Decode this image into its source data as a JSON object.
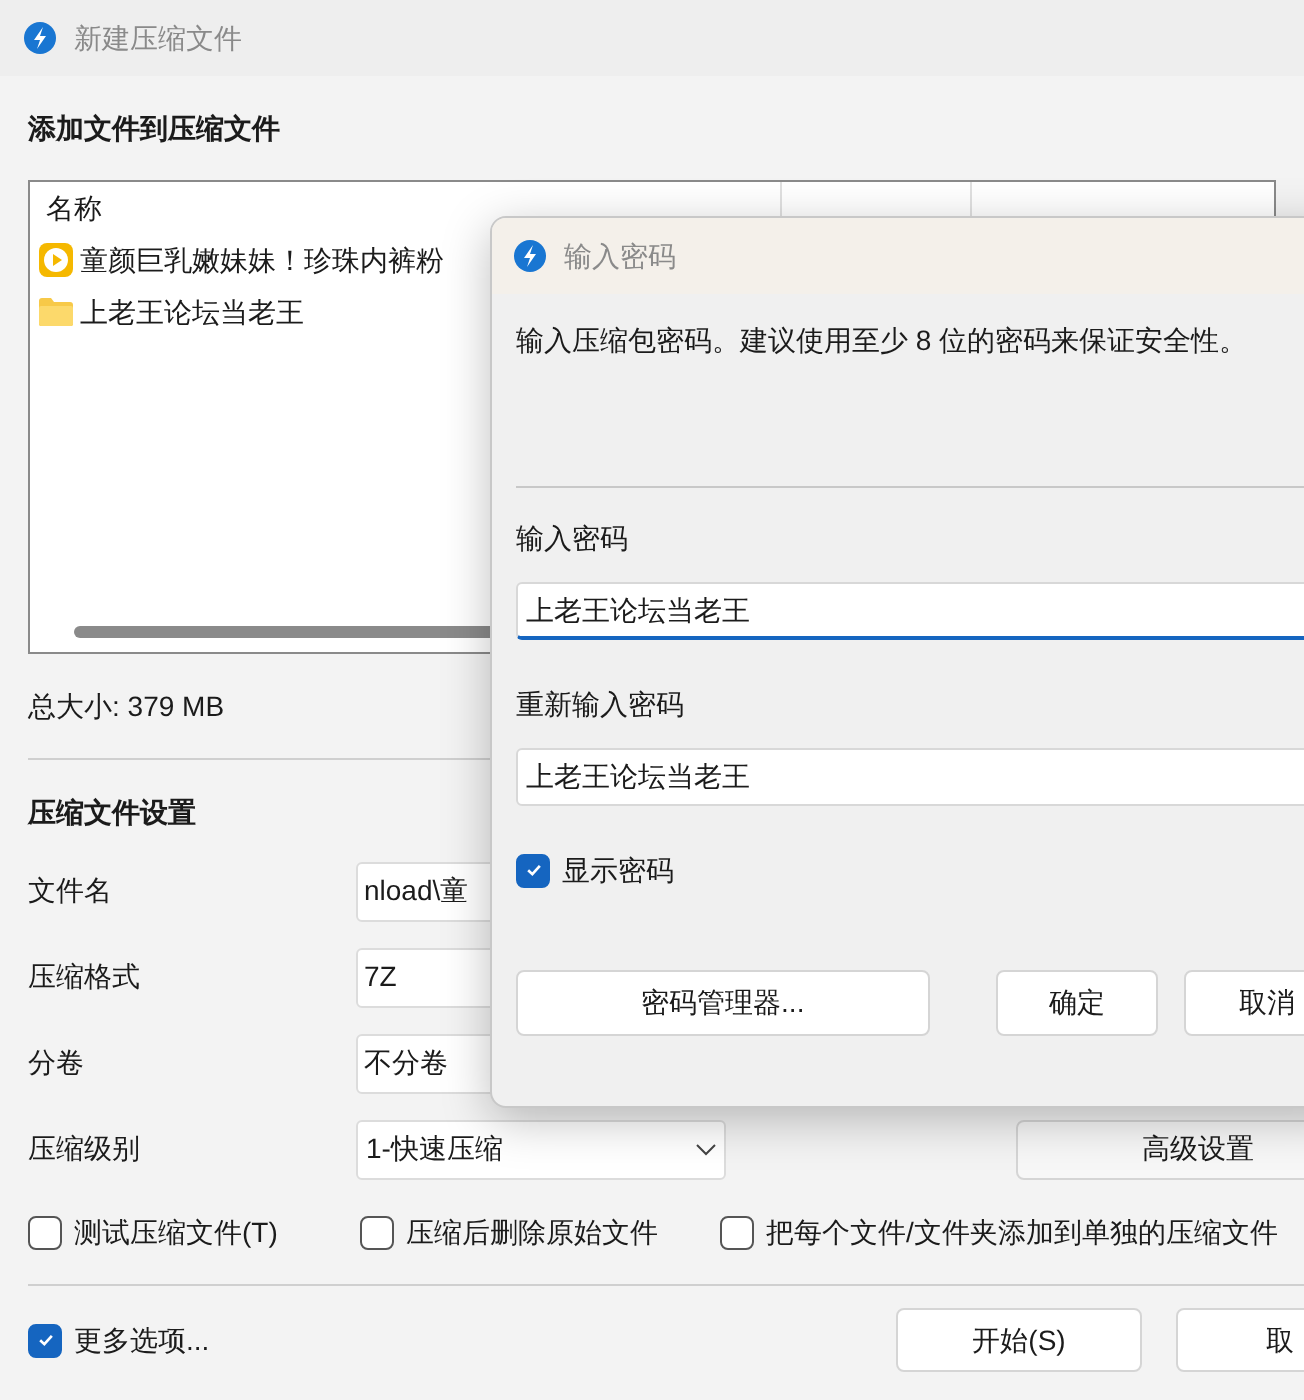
{
  "main_window": {
    "title": "新建压缩文件",
    "file_section": {
      "heading": "添加文件到压缩文件",
      "columns": [
        "名称"
      ],
      "rows": [
        {
          "kind": "video",
          "name": "童颜巨乳嫩妹妹！珍珠内裤粉"
        },
        {
          "kind": "folder",
          "name": "上老王论坛当老王"
        }
      ]
    },
    "total_size": "总大小: 379 MB",
    "settings": {
      "heading": "压缩文件设置",
      "fields": [
        {
          "label": "文件名",
          "value": "nload\\童",
          "kind": "input"
        },
        {
          "label": "压缩格式",
          "value": "7Z",
          "kind": "input"
        },
        {
          "label": "分卷",
          "value": "不分卷",
          "kind": "input"
        },
        {
          "label": "压缩级别",
          "value": "1-快速压缩",
          "kind": "dropdown"
        }
      ]
    },
    "advanced_button": "高级设置",
    "options": [
      {
        "label": "测试压缩文件(T)",
        "checked": false
      },
      {
        "label": "压缩后删除原始文件",
        "checked": false
      },
      {
        "label": "把每个文件/文件夹添加到单独的压缩文件",
        "checked": false
      }
    ],
    "more_options": {
      "label": "更多选项...",
      "checked": true
    },
    "buttons": [
      "开始(S)",
      "取"
    ]
  },
  "password_dialog": {
    "title": "输入密码",
    "description": "输入压缩包密码。建议使用至少 8 位的密码来保证安全性。",
    "fields": [
      {
        "label": "输入密码",
        "value": "上老王论坛当老王",
        "focused": true
      },
      {
        "label": "重新输入密码",
        "value": "上老王论坛当老王",
        "focused": false
      }
    ],
    "show_password": {
      "label": "显示密码",
      "checked": true
    },
    "buttons": [
      "密码管理器...",
      "确定",
      "取消"
    ]
  }
}
